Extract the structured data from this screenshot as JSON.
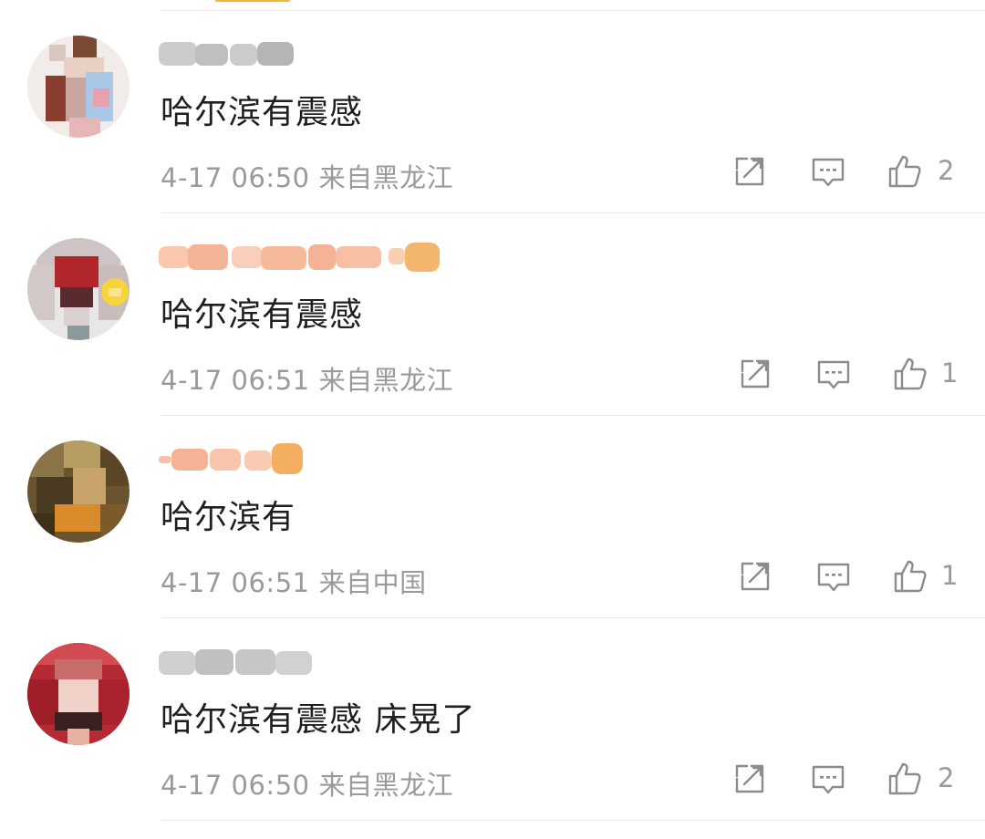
{
  "comments": [
    {
      "text": "哈尔滨有震感",
      "time": "4-17 06:50",
      "source": "来自黑龙江",
      "likes": "2",
      "username_color": "#b8b8b8",
      "vip_badge": false
    },
    {
      "text": "哈尔滨有震感",
      "time": "4-17 06:51",
      "source": "来自黑龙江",
      "likes": "1",
      "username_color": "#f6a05c",
      "vip_badge": true
    },
    {
      "text": "哈尔滨有",
      "time": "4-17 06:51",
      "source": "来自中国",
      "likes": "1",
      "username_color": "#f6a05c",
      "vip_badge": false
    },
    {
      "text": "哈尔滨有震感 床晃了",
      "time": "4-17 06:50",
      "source": "来自黑龙江",
      "likes": "2",
      "username_color": "#b8b8b8",
      "vip_badge": false
    }
  ],
  "icons": {
    "repost": "share-out-icon",
    "comment": "comment-bubble-icon",
    "like": "thumbs-up-icon"
  },
  "colors": {
    "text": "#1f1f1f",
    "meta": "#9a9a9a",
    "divider": "#e6e6e6",
    "accent": "#f5b53a"
  }
}
